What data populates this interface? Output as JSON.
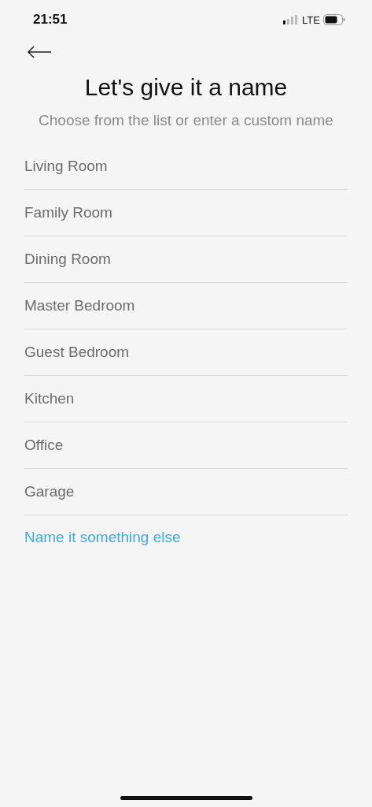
{
  "status_bar": {
    "time": "21:51",
    "network": "LTE"
  },
  "title": "Let's give it a name",
  "subtitle": "Choose from the list or enter a custom name",
  "options": [
    "Living Room",
    "Family Room",
    "Dining Room",
    "Master Bedroom",
    "Guest Bedroom",
    "Kitchen",
    "Office",
    "Garage"
  ],
  "custom_link": "Name it something else"
}
